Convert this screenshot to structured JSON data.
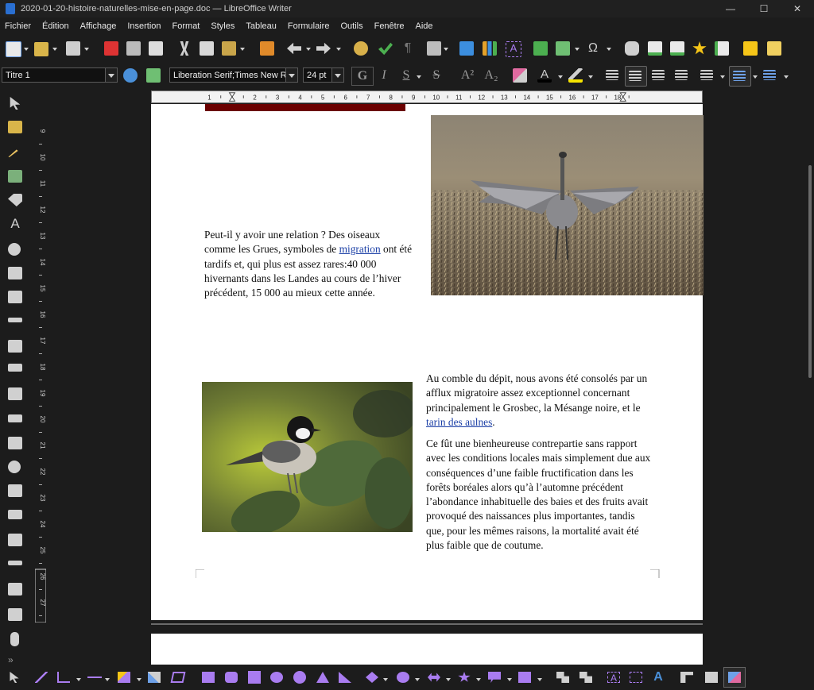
{
  "window": {
    "title": "2020-01-20-histoire-naturelles-mise-en-page.doc — LibreOffice Writer",
    "minimize": "—",
    "maximize": "☐",
    "close": "✕"
  },
  "menu": [
    "Fichier",
    "Édition",
    "Affichage",
    "Insertion",
    "Format",
    "Styles",
    "Tableau",
    "Formulaire",
    "Outils",
    "Fenêtre",
    "Aide"
  ],
  "formatting": {
    "paragraph_style": "Titre 1",
    "font_name": "Liberation Serif;Times New Roman",
    "font_size": "24 pt",
    "bold": "G",
    "italic": "I",
    "underline": "S",
    "strike": "S",
    "superscript": "A²",
    "subscript": "A₂"
  },
  "ruler": {
    "horizontal": [
      "1",
      "1",
      "2",
      "3",
      "4",
      "5",
      "6",
      "7",
      "8",
      "9",
      "10",
      "11",
      "12",
      "13",
      "14",
      "15",
      "16",
      "17",
      "18"
    ],
    "vertical": [
      "9",
      "10",
      "11",
      "12",
      "13",
      "14",
      "15",
      "16",
      "17",
      "18",
      "19",
      "20",
      "21",
      "22",
      "23",
      "24",
      "25",
      "26",
      "27"
    ]
  },
  "document": {
    "paragraph1": {
      "before": "Peut-il y avoir une relation ? Des oiseaux comme les Grues, symboles de ",
      "link": "migration",
      "after": " ont été tardifs et, qui plus est assez rares:40 000 hivernants dans les Landes au cours de l’hiver précédent, 15 000 au mieux cette année."
    },
    "paragraph2": {
      "before": "Au comble du dépit, nous avons été consolés par un afflux migratoire assez exceptionnel concernant principalement le Grosbec, la Mésange noire, et le ",
      "link": "tarin des aulnes",
      "after": "."
    },
    "paragraph3": "Ce fût une bienheureuse contrepartie sans rapport avec les conditions locales mais simplement due aux conséquences d’une faible fructification dans les forêts boréales alors qu’à l’automne précédent l’abondance inhabituelle des baies et des fruits avait provoqué des naissances plus importantes, tandis que, pour les mêmes raisons, la mortalité avait été plus faible que de coutume."
  },
  "images": {
    "crane": "crane-photo",
    "tit": "coal-tit-photo"
  },
  "colors": {
    "accent": "#2a6fd1",
    "shape_purple": "#a97cf0",
    "link": "#1b3fa6"
  }
}
